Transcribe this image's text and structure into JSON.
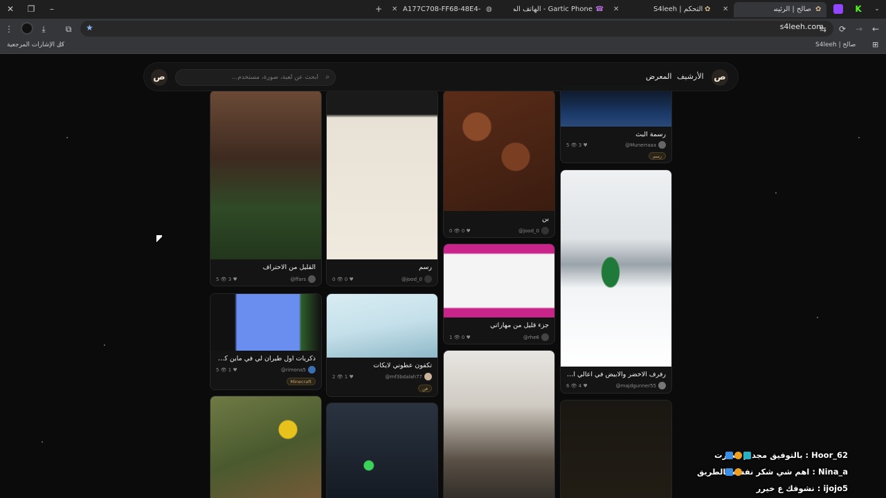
{
  "window": {
    "close_glyph": "✕",
    "restore_glyph": "❐",
    "minimize_glyph": "–",
    "new_tab_glyph": "+"
  },
  "tabs": [
    {
      "label": "A177C708-FF68-48E4-8F27-CF...",
      "close": "✕"
    },
    {
      "label": "Gartic Phone - الهاتف المكسور",
      "close": "✕"
    },
    {
      "label": "S4leeh | لوحة التحكم",
      "close": "✕"
    },
    {
      "label": "صالح | الرئيسية",
      "close": "✕"
    }
  ],
  "address_bar": {
    "url": "s4leeh.com",
    "back": "←",
    "forward": "→",
    "reload": "⟳",
    "star": "★"
  },
  "bookmarks": {
    "all_bookmarks": "كل الإشارات المرجعية",
    "item": "S4leeh | صالح"
  },
  "site": {
    "nav_archive": "الأرشيف",
    "nav_gallery": "المعرض",
    "search_placeholder": "ابحث عن لعبة، صورة، مستخدم...",
    "logo_text": "ص"
  },
  "cards": [
    {
      "title": "القليل من الاحتراف",
      "user": "@ffars",
      "stats": "5 👁  3 ♥"
    },
    {
      "title": "رسم",
      "user": "@jood_0",
      "stats": "0 👁  0 ♥"
    },
    {
      "title": "بن",
      "user": "@jood_0",
      "stats": "0 👁  0 ♥"
    },
    {
      "title": "رسمة البث",
      "user": "@Munerraaa",
      "stats": "5 👁  3 ♥",
      "tag": "رسم"
    },
    {
      "title": "ذكريات اول طيران لي في ماين كرافت ...",
      "user": "@rimona5",
      "stats": "5 👁  1 ♥",
      "tag": "Minecraft"
    },
    {
      "title": "تكفون عطوني لايكات",
      "user": "@mf3bdalah77",
      "stats": "2 👁  1 ♥",
      "tag": "فن"
    },
    {
      "title": "جزء قليل من مهاراتي",
      "user": "@rhe6",
      "stats": "1 👁  0 ♥"
    },
    {
      "title": "رفرف الاخضر والابيض في اعالي القمم",
      "user": "@majdgunner55",
      "stats": "6 👁  4 ♥"
    }
  ],
  "chat": [
    {
      "user": "Hoor_62",
      "text": "بالتوفيق مجد م قصرت : "
    },
    {
      "user": "Nina_a",
      "text": "اهم شي شكر نفسه بالطريق : "
    },
    {
      "user": "ijojo5",
      "text": "نشوفك ع خيرر : "
    }
  ],
  "colors": {
    "page_bg": "#0b0b0b",
    "card_bg": "#141414",
    "accent_tag": "#c9a86a"
  }
}
